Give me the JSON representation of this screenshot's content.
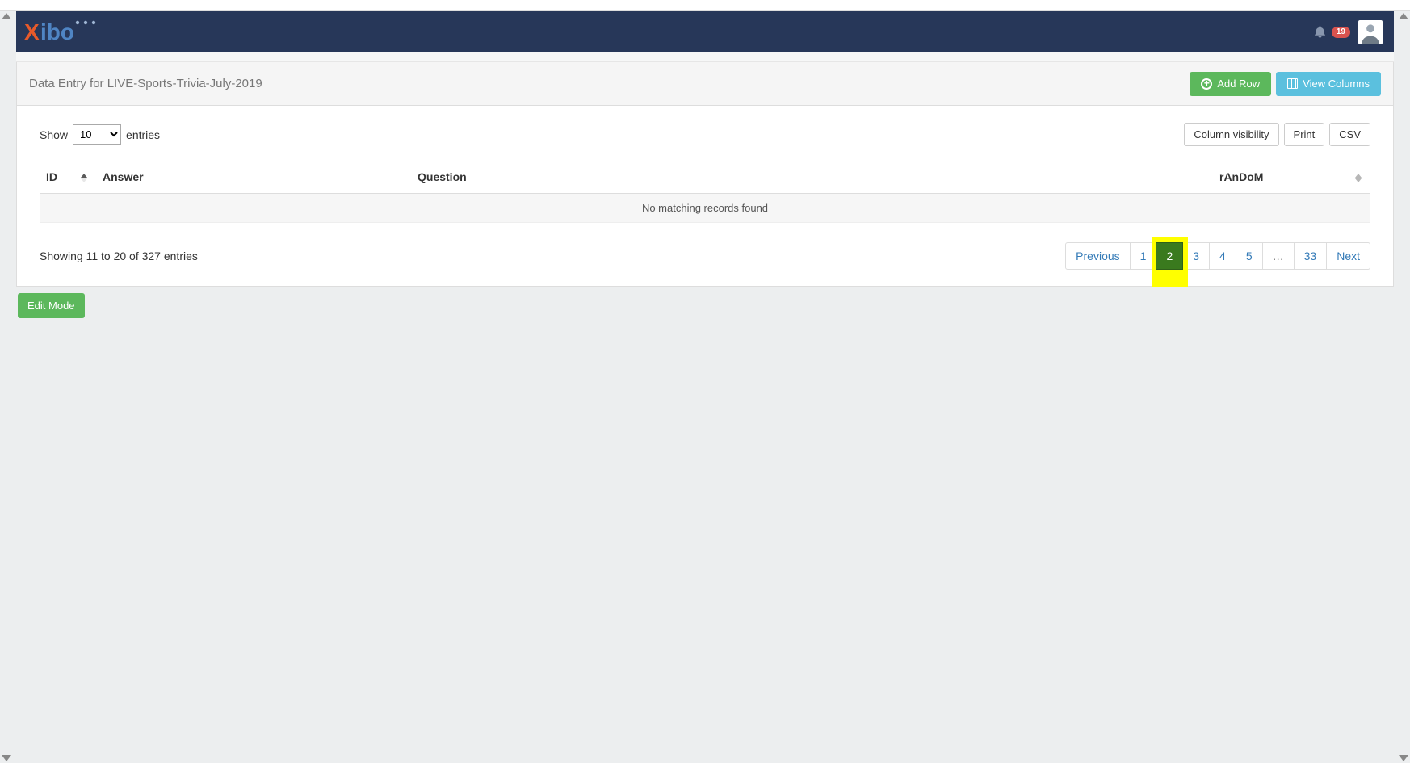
{
  "topnav": {
    "notification_count": "19"
  },
  "header": {
    "title": "Data Entry for LIVE-Sports-Trivia-July-2019",
    "add_row_label": "Add Row",
    "view_columns_label": "View Columns"
  },
  "toolbar": {
    "show_label": "Show",
    "entries_label": "entries",
    "entries_value": "10",
    "column_visibility_label": "Column visibility",
    "print_label": "Print",
    "csv_label": "CSV"
  },
  "table": {
    "columns": {
      "id": "ID",
      "answer": "Answer",
      "question": "Question",
      "random": "rAnDoM"
    },
    "empty_message": "No matching records found"
  },
  "footer": {
    "info": "Showing 11 to 20 of 327 entries",
    "previous_label": "Previous",
    "next_label": "Next",
    "ellipsis_label": "…",
    "pages": {
      "p1": "1",
      "p2": "2",
      "p3": "3",
      "p4": "4",
      "p5": "5",
      "p33": "33"
    }
  },
  "edit_mode_label": "Edit Mode"
}
